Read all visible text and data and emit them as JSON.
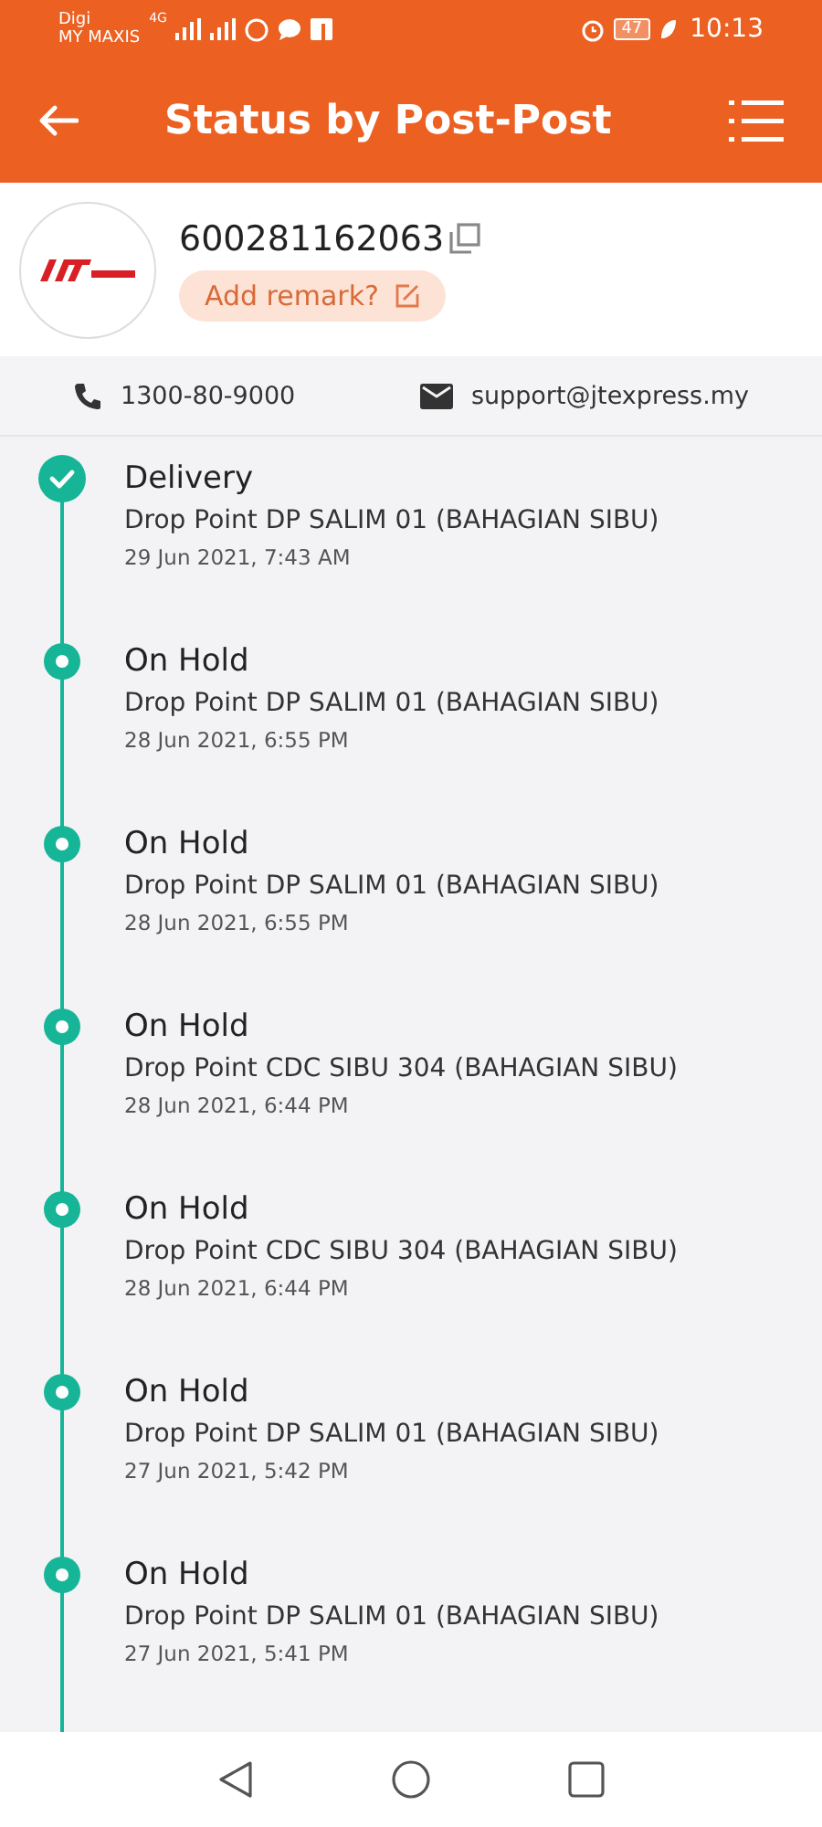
{
  "status_bar": {
    "carrier_top": "Digi",
    "carrier_bottom": "MY MAXIS",
    "network": "4G",
    "battery": "47",
    "time": "10:13"
  },
  "app_bar": {
    "title": "Status by Post-Post"
  },
  "parcel": {
    "tracking_number": "600281162063",
    "remark_button": "Add remark?"
  },
  "contacts": {
    "phone": "1300-80-9000",
    "email": "support@jtexpress.my"
  },
  "events": [
    {
      "kind": "done",
      "status": "Delivery",
      "location": "Drop Point DP SALIM 01 (BAHAGIAN SIBU)",
      "time": "29 Jun 2021, 7:43 AM"
    },
    {
      "kind": "hold",
      "status": "On Hold",
      "location": "Drop Point DP SALIM 01 (BAHAGIAN SIBU)",
      "time": "28 Jun 2021, 6:55 PM"
    },
    {
      "kind": "hold",
      "status": "On Hold",
      "location": "Drop Point DP SALIM 01 (BAHAGIAN SIBU)",
      "time": "28 Jun 2021, 6:55 PM"
    },
    {
      "kind": "hold",
      "status": "On Hold",
      "location": "Drop Point CDC SIBU 304 (BAHAGIAN SIBU)",
      "time": "28 Jun 2021, 6:44 PM"
    },
    {
      "kind": "hold",
      "status": "On Hold",
      "location": "Drop Point CDC SIBU 304 (BAHAGIAN SIBU)",
      "time": "28 Jun 2021, 6:44 PM"
    },
    {
      "kind": "hold",
      "status": "On Hold",
      "location": "Drop Point DP SALIM 01 (BAHAGIAN SIBU)",
      "time": "27 Jun 2021, 5:42 PM"
    },
    {
      "kind": "hold",
      "status": "On Hold",
      "location": "Drop Point DP SALIM 01 (BAHAGIAN SIBU)",
      "time": "27 Jun 2021, 5:41 PM"
    }
  ]
}
